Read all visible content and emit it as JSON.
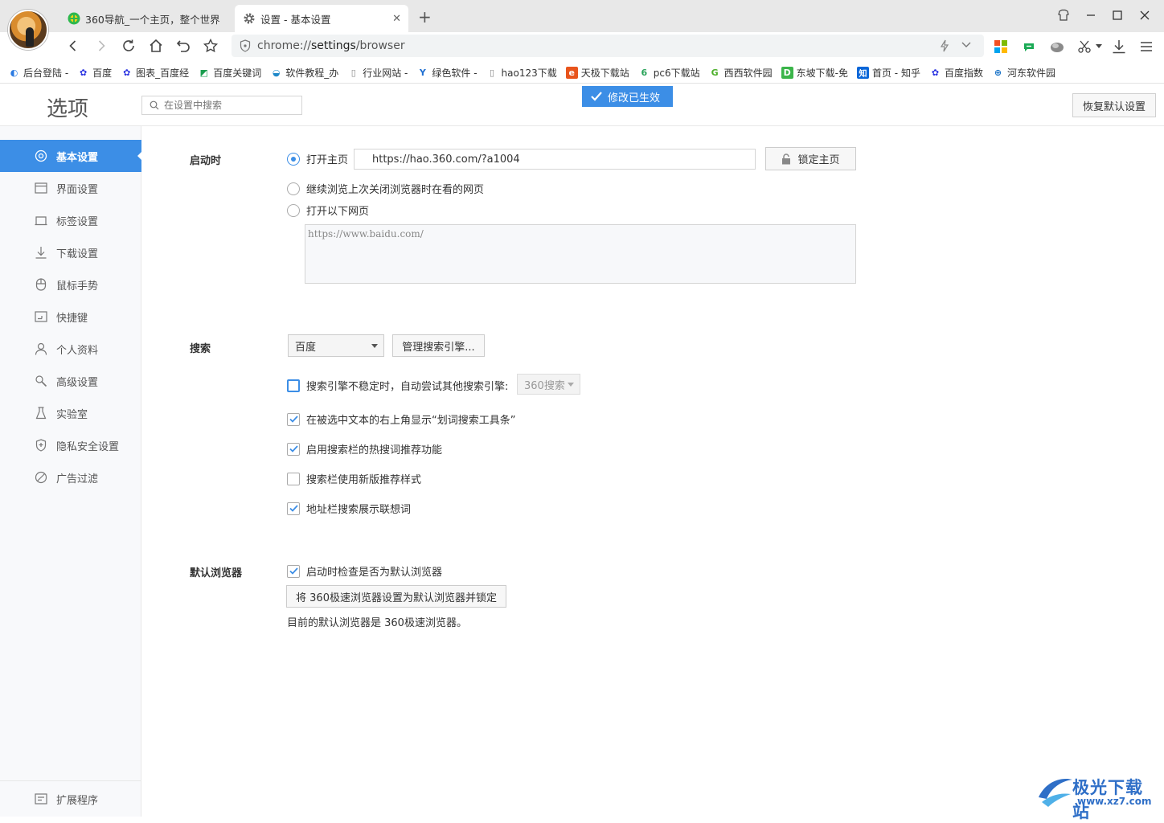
{
  "window": {
    "tabs": [
      {
        "label": "360导航_一个主页，整个世界",
        "icon": "360-nav-icon",
        "active": false
      },
      {
        "label": "设置 - 基本设置",
        "icon": "gear-icon",
        "active": true
      }
    ],
    "new_tab_glyph": "+"
  },
  "toolbar": {
    "url_prefix": "chrome://",
    "url_host": "settings",
    "url_path": "/browser"
  },
  "bookmarks": [
    {
      "label": "后台登陆 -",
      "icon": "site-icon",
      "color": "#2a7ae2"
    },
    {
      "label": "百度",
      "icon": "baidu-paw-icon",
      "color": "#2932e1"
    },
    {
      "label": "图表_百度经",
      "icon": "baidu-paw-icon",
      "color": "#2932e1"
    },
    {
      "label": "百度关键词",
      "icon": "keyword-icon",
      "color": "#1a9e4f"
    },
    {
      "label": "软件教程_办",
      "icon": "tutorial-icon",
      "color": "#1e88c9"
    },
    {
      "label": "行业网站 -",
      "icon": "page-icon",
      "color": "#888888"
    },
    {
      "label": "绿色软件 -",
      "icon": "green-soft-icon",
      "color": "#1f6fd1"
    },
    {
      "label": "hao123下载",
      "icon": "page-icon",
      "color": "#888888"
    },
    {
      "label": "天极下载站",
      "icon": "tianji-icon",
      "color": "#e8541c"
    },
    {
      "label": "pc6下载站",
      "icon": "pc6-icon",
      "color": "#2aa35a"
    },
    {
      "label": "西西软件园",
      "icon": "xixi-icon",
      "color": "#4caf2a"
    },
    {
      "label": "东坡下载-免",
      "icon": "dongpo-icon",
      "color": "#3bb54a"
    },
    {
      "label": "首页 - 知乎",
      "icon": "zhihu-icon",
      "color": "#0a66d8"
    },
    {
      "label": "百度指数",
      "icon": "baidu-paw-icon",
      "color": "#2932e1"
    },
    {
      "label": "河东软件园",
      "icon": "hedong-icon",
      "color": "#1a73c8"
    }
  ],
  "header": {
    "title": "选项",
    "search_placeholder": "在设置中搜索",
    "toast": "修改已生效",
    "restore_label": "恢复默认设置"
  },
  "sidebar": {
    "items": [
      {
        "label": "基本设置",
        "icon": "target-icon",
        "active": true
      },
      {
        "label": "界面设置",
        "icon": "window-icon"
      },
      {
        "label": "标签设置",
        "icon": "tab-icon"
      },
      {
        "label": "下载设置",
        "icon": "download-icon"
      },
      {
        "label": "鼠标手势",
        "icon": "mouse-icon"
      },
      {
        "label": "快捷键",
        "icon": "shortcut-icon"
      },
      {
        "label": "个人资料",
        "icon": "person-icon"
      },
      {
        "label": "高级设置",
        "icon": "wrench-icon"
      },
      {
        "label": "实验室",
        "icon": "flask-icon"
      },
      {
        "label": "隐私安全设置",
        "icon": "shield-icon"
      },
      {
        "label": "广告过滤",
        "icon": "block-icon"
      }
    ],
    "extensions_label": "扩展程序"
  },
  "startup": {
    "label": "启动时",
    "open_home_label": "打开主页",
    "home_url": "https://hao.360.com/?a1004",
    "lock_home_label": "锁定主页",
    "continue_label": "继续浏览上次关闭浏览器时在看的网页",
    "open_pages_label": "打开以下网页",
    "pages_value": "https://www.baidu.com/",
    "selected": "open_home"
  },
  "search": {
    "label": "搜索",
    "engine_selected": "百度",
    "manage_label": "管理搜索引擎...",
    "fallback_label": "搜索引擎不稳定时，自动尝试其他搜索引擎:",
    "fallback_engine": "360搜索",
    "fallback_checked": false,
    "options": [
      {
        "label": "在被选中文本的右上角显示“划词搜索工具条”",
        "checked": true
      },
      {
        "label": "启用搜索栏的热搜词推荐功能",
        "checked": true
      },
      {
        "label": "搜索栏使用新版推荐样式",
        "checked": false
      },
      {
        "label": "地址栏搜索展示联想词",
        "checked": true
      }
    ]
  },
  "default_browser": {
    "label": "默认浏览器",
    "check_label": "启动时检查是否为默认浏览器",
    "check_checked": true,
    "set_button_label": "将 360极速浏览器设置为默认浏览器并锁定",
    "status_text": "目前的默认浏览器是 360极速浏览器。"
  },
  "watermark": {
    "brand": "极光下载站",
    "url": "www.xz7.com"
  },
  "colors": {
    "accent": "#3c8ee6",
    "tabbar_bg": "#e8e8e8",
    "sidebar_bg": "#f8f9fb"
  }
}
